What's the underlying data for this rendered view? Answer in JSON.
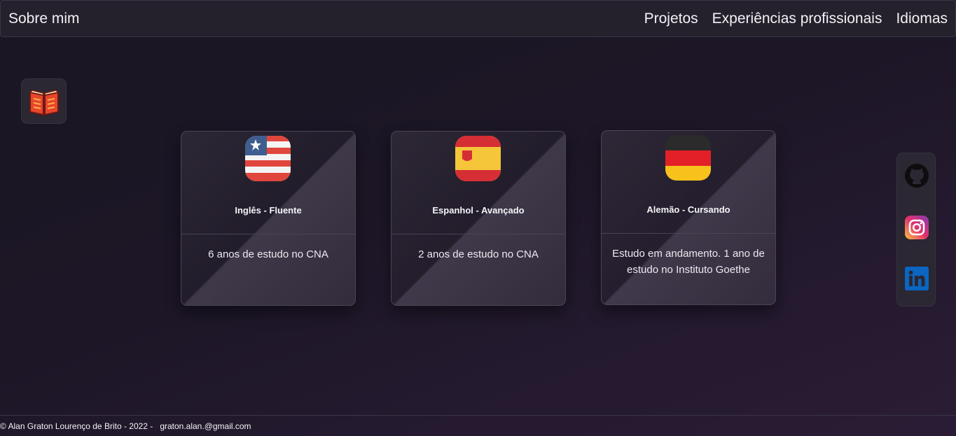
{
  "nav": {
    "brand": "Sobre mim",
    "links": [
      "Projetos",
      "Experiências profissionais",
      "Idiomas"
    ]
  },
  "book_button": {
    "icon": "book-icon"
  },
  "cards": [
    {
      "title": "Inglês - Fluente",
      "text": "6 anos de estudo no CNA",
      "flag": "us-flag-icon"
    },
    {
      "title": "Espanhol - Avançado",
      "text": "2 anos de estudo no CNA",
      "flag": "spain-flag-icon"
    },
    {
      "title": "Alemão - Cursando",
      "text": "Estudo em andamento. 1 ano de estudo no Instituto Goethe",
      "flag": "germany-flag-icon"
    }
  ],
  "social": [
    "github-icon",
    "instagram-icon",
    "linkedin-icon"
  ],
  "footer": {
    "copyright": "© Alan Graton Lourenço de Brito - 2022 -",
    "email": "graton.alan.@gmail.com"
  },
  "colors": {
    "background": "#1c1626",
    "navbar": "#25212c",
    "card_border": "#4a4454"
  }
}
